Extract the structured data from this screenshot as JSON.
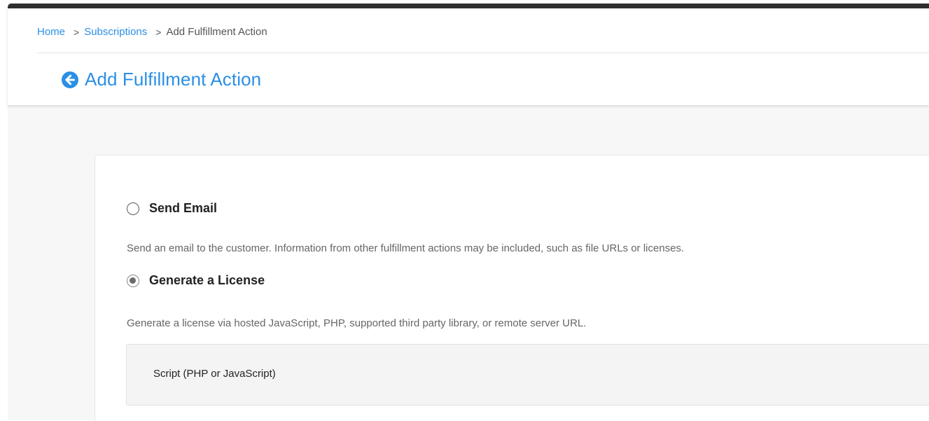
{
  "breadcrumb": {
    "home": "Home",
    "subscriptions": "Subscriptions",
    "current": "Add Fulfillment Action",
    "separator": ">"
  },
  "page": {
    "title": "Add Fulfillment Action",
    "back_icon": "circle-arrow-left-icon"
  },
  "options": {
    "send_email": {
      "label": "Send Email",
      "description": "Send an email to the customer. Information from other fulfillment actions may be included, such as file URLs or licenses.",
      "selected": false
    },
    "generate_license": {
      "label": "Generate a License",
      "description": "Generate a license via hosted JavaScript, PHP, supported third party library, or remote server URL.",
      "selected": true
    }
  },
  "license_type": {
    "label": "Script (PHP or JavaScript)"
  },
  "colors": {
    "accent": "#2b8fe6",
    "text_dark": "#222222",
    "text_muted": "#666666",
    "background": "#f7f7f7"
  }
}
